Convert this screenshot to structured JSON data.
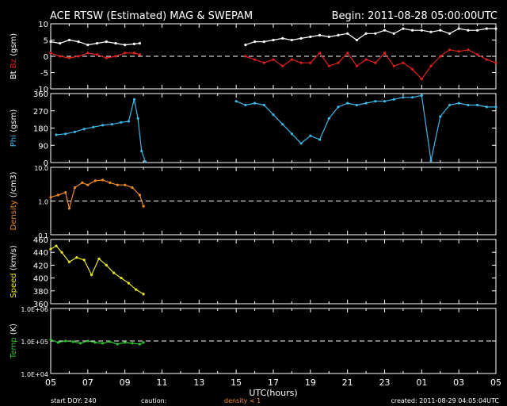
{
  "header": {
    "title": "ACE RTSW (Estimated) MAG & SWEPAM",
    "begin_label": "Begin: 2011-08-28 05:00:00UTC"
  },
  "footer": {
    "start_doy": "start DOY: 240",
    "caution": "caution:",
    "density_caution": "density < 1",
    "created": "created: 2011-08-29 04:05:04UTC"
  },
  "colors": {
    "background": "#000000",
    "axes": "#ffffff",
    "bt": "#ffffff",
    "bz": "#e02020",
    "phi": "#3fb6e8",
    "density": "#f08a24",
    "speed": "#e8e820",
    "temp": "#30c030",
    "dashed_ref": "#ffffff"
  },
  "chart_data": {
    "type": "scatter",
    "xlabel": "UTC(hours)",
    "x_tick_labels": [
      "05",
      "07",
      "09",
      "11",
      "13",
      "15",
      "17",
      "19",
      "21",
      "23",
      "01",
      "03",
      "05"
    ],
    "xlim": [
      0,
      24
    ],
    "panels": [
      {
        "id": "mag",
        "ylabel_parts": [
          {
            "text": "Bt",
            "color": "#ffffff"
          },
          {
            "text": "Bz",
            "color": "#e02020"
          },
          {
            "text": "(gsm)",
            "color": "#ffffff"
          }
        ],
        "ylim": [
          -10,
          10
        ],
        "yticks": [
          -10,
          -5,
          0,
          5,
          10
        ],
        "ytick_labels": [
          "-10",
          "-5",
          "0",
          "5",
          "10"
        ],
        "ref_line": 0,
        "series": [
          {
            "name": "Bt",
            "color": "#ffffff",
            "segments": [
              {
                "x": [
                  0.0,
                  0.5,
                  1.0,
                  1.5,
                  2.0,
                  2.5,
                  3.0,
                  3.5,
                  4.0,
                  4.5,
                  4.8
                ],
                "y": [
                  4.5,
                  4.0,
                  5.0,
                  4.5,
                  3.5,
                  4.0,
                  4.5,
                  4.0,
                  3.5,
                  3.8,
                  4.0
                ]
              },
              {
                "x": [
                  10.5,
                  11.0,
                  11.5,
                  12.0,
                  12.5,
                  13.0,
                  13.5,
                  14.0,
                  14.5,
                  15.0,
                  15.5,
                  16.0,
                  16.5,
                  17.0,
                  17.5,
                  18.0,
                  18.5,
                  19.0,
                  19.5,
                  20.0,
                  20.5,
                  21.0,
                  21.5,
                  22.0,
                  22.5,
                  23.0,
                  23.5,
                  24.0
                ],
                "y": [
                  3.5,
                  4.5,
                  4.5,
                  5.0,
                  5.5,
                  5.0,
                  5.5,
                  6.0,
                  6.5,
                  6.0,
                  6.5,
                  7.0,
                  5.0,
                  7.0,
                  7.0,
                  8.0,
                  7.0,
                  8.5,
                  8.0,
                  8.0,
                  7.5,
                  8.0,
                  7.0,
                  8.5,
                  8.0,
                  8.0,
                  8.5,
                  8.5
                ]
              }
            ]
          },
          {
            "name": "Bz",
            "color": "#e02020",
            "segments": [
              {
                "x": [
                  0.0,
                  0.5,
                  1.0,
                  1.5,
                  2.0,
                  2.5,
                  3.0,
                  3.5,
                  4.0,
                  4.5,
                  4.8
                ],
                "y": [
                  1.0,
                  0.0,
                  -0.5,
                  0.0,
                  1.0,
                  0.5,
                  -0.5,
                  0.0,
                  1.0,
                  1.0,
                  0.5
                ]
              },
              {
                "x": [
                  10.5,
                  11.0,
                  11.5,
                  12.0,
                  12.5,
                  13.0,
                  13.5,
                  14.0,
                  14.5,
                  15.0,
                  15.5,
                  16.0,
                  16.5,
                  17.0,
                  17.5,
                  18.0,
                  18.5,
                  19.0,
                  19.5,
                  20.0,
                  20.5,
                  21.0,
                  21.5,
                  22.0,
                  22.5,
                  23.0,
                  23.5,
                  24.0
                ],
                "y": [
                  0.0,
                  -1.0,
                  -2.0,
                  -1.0,
                  -3.0,
                  -1.0,
                  -2.0,
                  -2.0,
                  1.0,
                  -3.0,
                  -2.0,
                  1.0,
                  -3.0,
                  -1.0,
                  -2.0,
                  1.0,
                  -3.0,
                  -2.0,
                  -4.0,
                  -7.0,
                  -3.0,
                  0.0,
                  2.0,
                  1.5,
                  2.0,
                  0.5,
                  -1.0,
                  -2.0
                ]
              }
            ]
          }
        ]
      },
      {
        "id": "phi",
        "ylabel_parts": [
          {
            "text": "Phi",
            "color": "#3fb6e8"
          },
          {
            "text": "(gsm)",
            "color": "#ffffff"
          }
        ],
        "ylim": [
          0,
          360
        ],
        "yticks": [
          0,
          90,
          180,
          270,
          360
        ],
        "ytick_labels": [
          "0",
          "90",
          "180",
          "270",
          "360"
        ],
        "series": [
          {
            "name": "Phi",
            "color": "#3fb6e8",
            "segments": [
              {
                "x": [
                  0.3,
                  0.8,
                  1.3,
                  1.8,
                  2.3,
                  2.8,
                  3.3,
                  3.8,
                  4.2,
                  4.5,
                  4.7,
                  4.9,
                  5.1
                ],
                "y": [
                  145,
                  150,
                  160,
                  175,
                  185,
                  195,
                  200,
                  210,
                  215,
                  330,
                  230,
                  60,
                  5
                ]
              },
              {
                "x": [
                  10.0,
                  10.5,
                  11.0,
                  11.5,
                  12.0,
                  12.5,
                  13.0,
                  13.5,
                  14.0,
                  14.5,
                  15.0,
                  15.5,
                  16.0,
                  16.5,
                  17.0,
                  17.5,
                  18.0,
                  18.5,
                  19.0,
                  19.5,
                  20.0,
                  20.5,
                  21.0,
                  21.5,
                  22.0,
                  22.5,
                  23.0,
                  23.5,
                  24.0
                ],
                "y": [
                  320,
                  300,
                  310,
                  300,
                  250,
                  200,
                  150,
                  100,
                  140,
                  120,
                  230,
                  290,
                  310,
                  300,
                  310,
                  320,
                  320,
                  330,
                  340,
                  340,
                  350,
                  10,
                  240,
                  300,
                  310,
                  300,
                  300,
                  290,
                  290
                ]
              }
            ]
          }
        ]
      },
      {
        "id": "density",
        "ylabel_parts": [
          {
            "text": "Density",
            "color": "#f08a24"
          },
          {
            "text": "(/cm3)",
            "color": "#ffffff"
          }
        ],
        "log": true,
        "ylim": [
          0.1,
          10.0
        ],
        "yticks": [
          0.1,
          1.0,
          10.0
        ],
        "ytick_labels": [
          "0.1",
          "1.0",
          "10.0"
        ],
        "ref_line": 1.0,
        "series": [
          {
            "name": "Density",
            "color": "#f08a24",
            "segments": [
              {
                "x": [
                  0.0,
                  0.4,
                  0.8,
                  1.0,
                  1.3,
                  1.7,
                  2.0,
                  2.4,
                  2.8,
                  3.2,
                  3.6,
                  4.0,
                  4.4,
                  4.8,
                  5.0
                ],
                "y": [
                  1.3,
                  1.5,
                  1.8,
                  0.6,
                  2.5,
                  3.5,
                  3.0,
                  4.0,
                  4.2,
                  3.5,
                  3.0,
                  3.0,
                  2.5,
                  1.5,
                  0.7
                ]
              }
            ]
          }
        ]
      },
      {
        "id": "speed",
        "ylabel_parts": [
          {
            "text": "Speed",
            "color": "#e8e820"
          },
          {
            "text": "(km/s)",
            "color": "#ffffff"
          }
        ],
        "ylim": [
          360,
          460
        ],
        "yticks": [
          360,
          380,
          400,
          420,
          440,
          460
        ],
        "ytick_labels": [
          "360",
          "380",
          "400",
          "420",
          "440",
          "460"
        ],
        "series": [
          {
            "name": "Speed",
            "color": "#e8e820",
            "segments": [
              {
                "x": [
                  0.0,
                  0.3,
                  0.6,
                  1.0,
                  1.4,
                  1.8,
                  2.2,
                  2.6,
                  3.0,
                  3.4,
                  3.8,
                  4.2,
                  4.6,
                  5.0
                ],
                "y": [
                  445,
                  450,
                  440,
                  425,
                  432,
                  428,
                  405,
                  430,
                  420,
                  408,
                  400,
                  392,
                  382,
                  375
                ]
              }
            ]
          }
        ]
      },
      {
        "id": "temp",
        "ylabel_parts": [
          {
            "text": "Temp",
            "color": "#30c030"
          },
          {
            "text": "(K)",
            "color": "#ffffff"
          }
        ],
        "log": true,
        "ylim": [
          10000,
          1000000
        ],
        "yticks": [
          10000,
          100000,
          1000000
        ],
        "ytick_labels": [
          "1.0E+04",
          "1.0E+05",
          "1.0E+06"
        ],
        "ref_line": 100000,
        "series": [
          {
            "name": "Temp",
            "color": "#30c030",
            "segments": [
              {
                "x": [
                  0.0,
                  0.4,
                  0.8,
                  1.2,
                  1.6,
                  2.0,
                  2.4,
                  2.8,
                  3.2,
                  3.6,
                  4.0,
                  4.4,
                  4.8,
                  5.0
                ],
                "y": [
                  110000,
                  90000,
                  100000,
                  95000,
                  85000,
                  100000,
                  90000,
                  85000,
                  95000,
                  80000,
                  90000,
                  85000,
                  80000,
                  90000
                ]
              }
            ]
          }
        ]
      }
    ]
  }
}
